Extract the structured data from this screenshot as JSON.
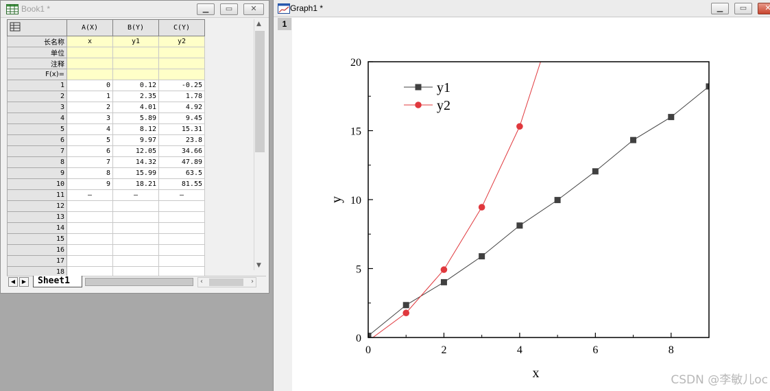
{
  "book": {
    "title": "Book1 *",
    "columns": [
      "A(X)",
      "B(Y)",
      "C(Y)"
    ],
    "meta_rows": [
      {
        "label": "长名称",
        "values": [
          "x",
          "y1",
          "y2"
        ]
      },
      {
        "label": "单位",
        "values": [
          "",
          "",
          ""
        ]
      },
      {
        "label": "注释",
        "values": [
          "",
          "",
          ""
        ]
      },
      {
        "label": "F(x)=",
        "values": [
          "",
          "",
          ""
        ]
      }
    ],
    "rows": [
      [
        "1",
        "0",
        "0.12",
        "-0.25"
      ],
      [
        "2",
        "1",
        "2.35",
        "1.78"
      ],
      [
        "3",
        "2",
        "4.01",
        "4.92"
      ],
      [
        "4",
        "3",
        "5.89",
        "9.45"
      ],
      [
        "5",
        "4",
        "8.12",
        "15.31"
      ],
      [
        "6",
        "5",
        "9.97",
        "23.8"
      ],
      [
        "7",
        "6",
        "12.05",
        "34.66"
      ],
      [
        "8",
        "7",
        "14.32",
        "47.89"
      ],
      [
        "9",
        "8",
        "15.99",
        "63.5"
      ],
      [
        "10",
        "9",
        "18.21",
        "81.55"
      ],
      [
        "11",
        "—",
        "—",
        "—"
      ],
      [
        "12",
        "",
        "",
        ""
      ],
      [
        "13",
        "",
        "",
        ""
      ],
      [
        "14",
        "",
        "",
        ""
      ],
      [
        "15",
        "",
        "",
        ""
      ],
      [
        "16",
        "",
        "",
        ""
      ],
      [
        "17",
        "",
        "",
        ""
      ],
      [
        "18",
        "",
        "",
        ""
      ]
    ],
    "sheet_tab": "Sheet1"
  },
  "graph": {
    "title": "Graph1 *",
    "layer": "1",
    "watermark": "CSDN @李敏儿oc"
  },
  "chart_data": {
    "type": "line",
    "xlabel": "x",
    "ylabel": "y",
    "xlim": [
      0,
      9
    ],
    "ylim": [
      0,
      20
    ],
    "xticks": [
      0,
      2,
      4,
      6,
      8
    ],
    "yticks": [
      0,
      5,
      10,
      15,
      20
    ],
    "legend_position": "top-left",
    "series": [
      {
        "name": "y1",
        "color": "#404040",
        "marker": "square",
        "x": [
          0,
          1,
          2,
          3,
          4,
          5,
          6,
          7,
          8,
          9
        ],
        "y": [
          0.12,
          2.35,
          4.01,
          5.89,
          8.12,
          9.97,
          12.05,
          14.32,
          15.99,
          18.21
        ]
      },
      {
        "name": "y2",
        "color": "#e0383d",
        "marker": "circle",
        "x": [
          0,
          1,
          2,
          3,
          4,
          5,
          6,
          7,
          8,
          9
        ],
        "y": [
          -0.25,
          1.78,
          4.92,
          9.45,
          15.31,
          23.8,
          34.66,
          47.89,
          63.5,
          81.55
        ]
      }
    ]
  }
}
